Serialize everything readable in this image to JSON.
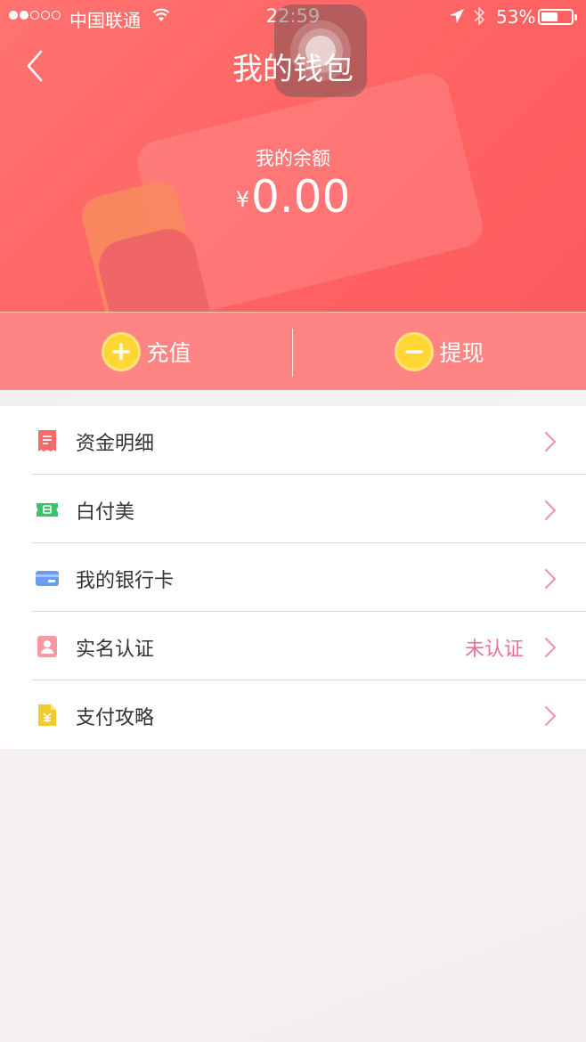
{
  "status_bar": {
    "carrier": "中国联通",
    "time": "22:59",
    "battery_pct": "53%"
  },
  "header": {
    "title": "我的钱包",
    "balance_label": "我的余额",
    "currency": "¥",
    "balance": "0.00"
  },
  "actions": {
    "recharge": "充值",
    "withdraw": "提现"
  },
  "menu": {
    "items": [
      {
        "label": "资金明细",
        "icon": "receipt-icon",
        "status": ""
      },
      {
        "label": "白付美",
        "icon": "ticket-icon",
        "status": ""
      },
      {
        "label": "我的银行卡",
        "icon": "bank-card-icon",
        "status": ""
      },
      {
        "label": "实名认证",
        "icon": "id-card-icon",
        "status": "未认证"
      },
      {
        "label": "支付攻略",
        "icon": "yen-document-icon",
        "status": ""
      }
    ]
  },
  "colors": {
    "header": "#ff6a67",
    "action_bar": "#ff8484",
    "action_circle": "#ffd633",
    "status_text": "#ee6e9a",
    "chevron": "#f08fb0"
  }
}
